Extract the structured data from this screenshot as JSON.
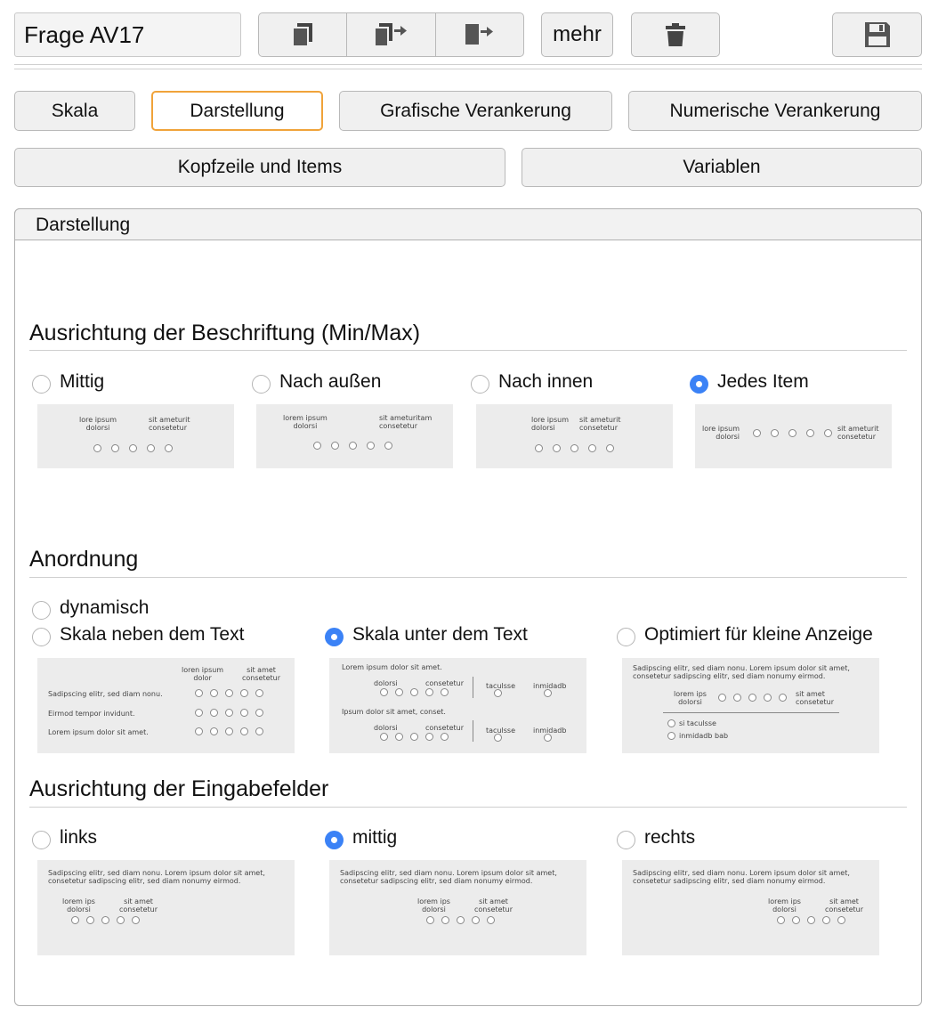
{
  "toolbar": {
    "question_name": "Frage AV17",
    "more_label": "mehr",
    "icons": [
      "copy-icon",
      "copy-move-icon",
      "move-icon",
      "trash-icon",
      "save-icon"
    ]
  },
  "tabs": {
    "skala": "Skala",
    "darstellung": "Darstellung",
    "grafische": "Grafische Verankerung",
    "numerische": "Numerische Verankerung",
    "kopfzeile": "Kopfzeile und Items",
    "variablen": "Variablen",
    "active": "Darstellung",
    "active_color": "#f0a33a"
  },
  "panel": {
    "title": "Darstellung"
  },
  "section1": {
    "title": "Ausrichtung der Beschriftung (Min/Max)",
    "options": [
      "Mittig",
      "Nach außen",
      "Nach innen",
      "Jedes Item"
    ],
    "selected": "Jedes Item",
    "previews": {
      "p1": {
        "min": [
          "lore ipsum",
          "dolorsi"
        ],
        "max": [
          "sit ameturit",
          "consetetur"
        ]
      },
      "p2": {
        "min": [
          "lorem ipsum",
          "dolorsi"
        ],
        "max": [
          "sit ameturitam",
          "consetetur"
        ]
      },
      "p3": {
        "min": [
          "lore ipsum",
          "dolorsi"
        ],
        "max": [
          "sit ameturit",
          "consetetur"
        ]
      },
      "p4": {
        "min": [
          "lore ipsum",
          "dolorsi"
        ],
        "max": [
          "sit ameturit",
          "consetetur"
        ]
      }
    }
  },
  "section2": {
    "title": "Anordnung",
    "opt_dynamic": "dynamisch",
    "opt_next": "Skala neben dem Text",
    "opt_below": "Skala unter dem Text",
    "opt_small": "Optimiert für kleine Anzeige",
    "selected": "Skala unter dem Text",
    "preview_next": {
      "head1": [
        "loren ipsum",
        "dolor"
      ],
      "head2": [
        "sit amet",
        "consetetur"
      ],
      "rows": [
        "Sadipscing elitr, sed diam nonu.",
        "Eirmod tempor invidunt.",
        "Lorem ipsum dolor sit amet."
      ]
    },
    "preview_below": {
      "q1": "Lorem ipsum dolor sit amet.",
      "q2": "Ipsum dolor sit amet, conset.",
      "lab_min": "dolorsi",
      "lab_max": "consetetur",
      "extra1": "taculsse",
      "extra2": "inmidadb"
    },
    "preview_small": {
      "text1": "Sadipscing elitr, sed diam nonu. Lorem ipsum dolor sit amet,",
      "text2": "consetetur sadipscing elitr, sed diam nonumy eirmod.",
      "min": [
        "lorem ips",
        "dolorsi"
      ],
      "max": [
        "sit amet",
        "consetetur"
      ],
      "choices": [
        "si taculsse",
        "inmidadb bab"
      ]
    }
  },
  "section3": {
    "title": "Ausrichtung der Eingabefelder",
    "options": [
      "links",
      "mittig",
      "rechts"
    ],
    "selected": "mittig",
    "preview": {
      "text1": "Sadipscing elitr, sed diam nonu. Lorem ipsum dolor sit amet,",
      "text2": "consetetur sadipscing elitr, sed diam nonumy eirmod.",
      "min": [
        "lorem ips",
        "dolorsi"
      ],
      "max": [
        "sit amet",
        "consetetur"
      ]
    }
  }
}
